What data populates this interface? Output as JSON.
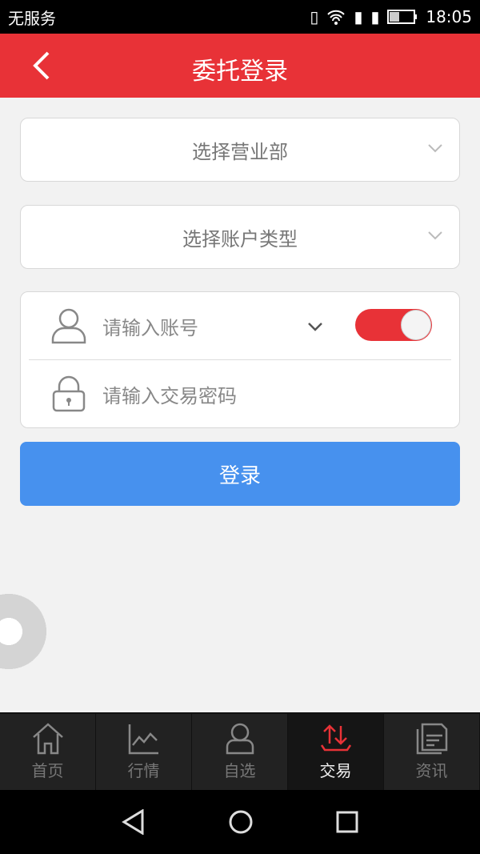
{
  "status": {
    "carrier": "无服务",
    "time": "18:05"
  },
  "header": {
    "title": "委托登录"
  },
  "form": {
    "branch_placeholder": "选择营业部",
    "account_type_placeholder": "选择账户类型",
    "account_placeholder": "请输入账号",
    "password_placeholder": "请输入交易密码",
    "toggle_on": true,
    "login_label": "登录"
  },
  "tabs": [
    {
      "label": "首页",
      "icon": "home-icon"
    },
    {
      "label": "行情",
      "icon": "chart-icon"
    },
    {
      "label": "自选",
      "icon": "user-icon"
    },
    {
      "label": "交易",
      "icon": "trade-icon",
      "active": true
    },
    {
      "label": "资讯",
      "icon": "news-icon"
    }
  ],
  "colors": {
    "brand": "#e83237",
    "primary": "#4791ee"
  }
}
